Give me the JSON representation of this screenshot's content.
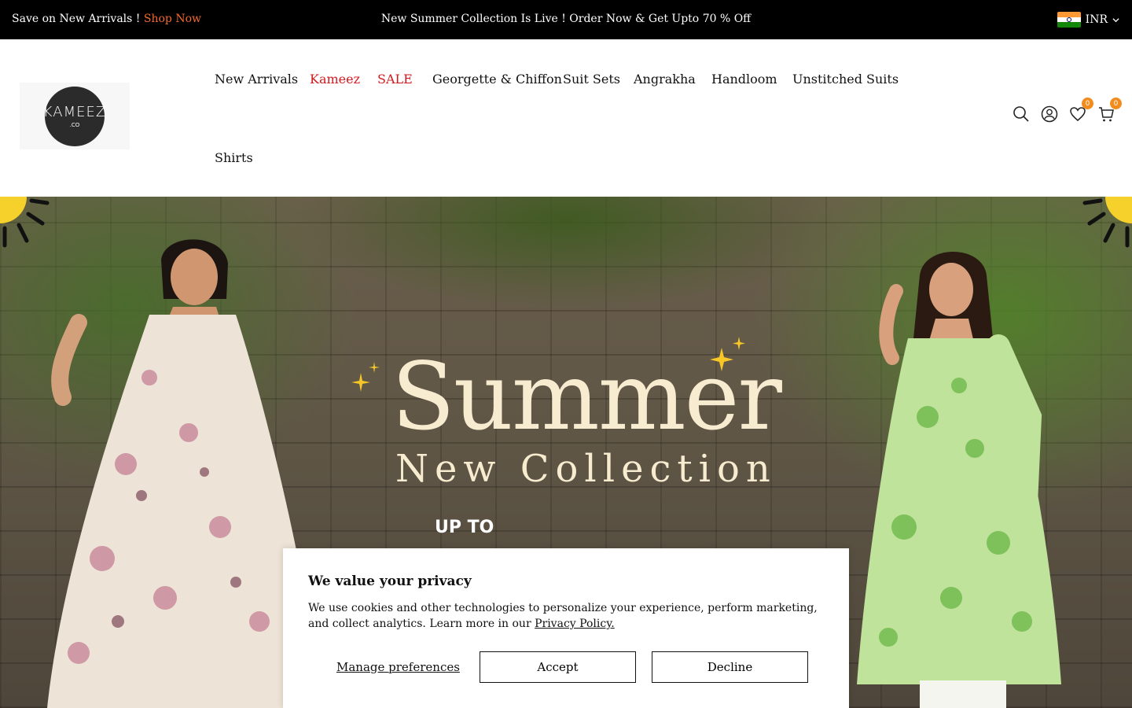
{
  "announcement": {
    "left_text": "Save on New Arrivals ! ",
    "left_link": "Shop Now",
    "center_text": "New Summer Collection Is Live ! Order Now & Get Upto 70 % Off",
    "currency": "INR",
    "link_color": "#f26a2e"
  },
  "header": {
    "logo_text": "KAMEEZ",
    "logo_sub": ".CO",
    "nav": [
      {
        "label": "New Arrivals"
      },
      {
        "label": "Kameez"
      },
      {
        "label": "SALE"
      },
      {
        "label": "Georgette & Chiffon"
      },
      {
        "label": "Suit Sets"
      },
      {
        "label": "Angrakha"
      },
      {
        "label": "Handloom"
      },
      {
        "label": "Unstitched Suits"
      },
      {
        "label": "Shirts"
      }
    ],
    "icons": [
      "search-icon",
      "account-icon",
      "wishlist-icon",
      "cart-icon"
    ],
    "wishlist_count": "0",
    "cart_count": "0",
    "accent_color": "#d2191e",
    "badge_color": "#f28c1e"
  },
  "hero": {
    "headline": "Summer",
    "subheadline": "New Collection",
    "upto": "UP TO",
    "headline_color": "#f8ecd0",
    "offer_color": "#f2c41c"
  },
  "cookie": {
    "title": "We value your privacy",
    "text": "We use cookies and other technologies to personalize your experience, perform marketing, and collect analytics. Learn more in our ",
    "policy_link": "Privacy Policy.",
    "manage_label": "Manage preferences",
    "accept_label": "Accept",
    "decline_label": "Decline"
  }
}
